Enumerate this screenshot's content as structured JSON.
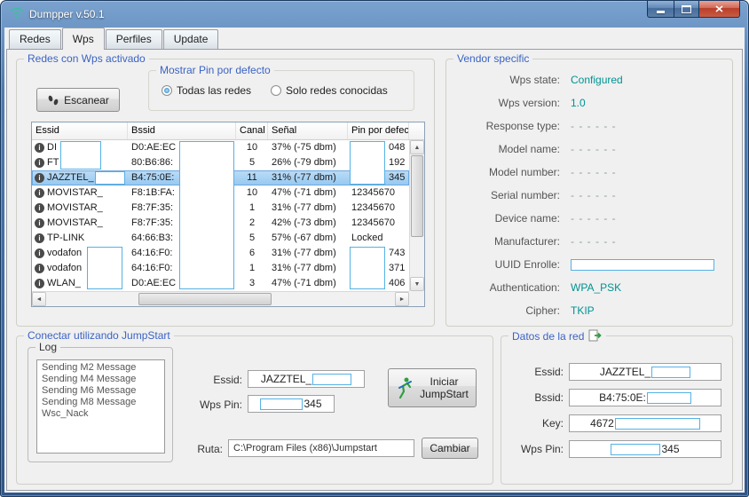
{
  "window": {
    "title": "Dumpper v.50.1"
  },
  "colors": {
    "caption_blue": "#3b63c3",
    "value_teal": "#009292",
    "censor_border": "#55b1e4",
    "selection_blue": "#95c8f1"
  },
  "tabs": [
    {
      "label": "Redes",
      "active": false
    },
    {
      "label": "Wps",
      "active": true
    },
    {
      "label": "Perfiles",
      "active": false
    },
    {
      "label": "Update",
      "active": false
    }
  ],
  "networks": {
    "title": "Redes con Wps activado",
    "scan_button": "Escanear",
    "pin_filter": {
      "title": "Mostrar Pin por defecto",
      "options": [
        {
          "label": "Todas las redes",
          "selected": true
        },
        {
          "label": "Solo redes conocidas",
          "selected": false
        }
      ]
    },
    "columns": [
      "Essid",
      "Bssid",
      "Canal",
      "Señal",
      "Pin por defecto"
    ],
    "rows": [
      {
        "essid": "DI",
        "bssid": "D0:AE:EC",
        "canal": "10",
        "senal": "37% (-75 dbm)",
        "pin": "048",
        "pin_censored": true,
        "selected": false
      },
      {
        "essid": "FT",
        "bssid": "80:B6:86:",
        "canal": "5",
        "senal": "26% (-79 dbm)",
        "pin": "192",
        "pin_censored": true,
        "selected": false
      },
      {
        "essid": "JAZZTEL_",
        "bssid": "B4:75:0E:",
        "canal": "11",
        "senal": "31% (-77 dbm)",
        "pin": "345",
        "pin_censored": true,
        "selected": true
      },
      {
        "essid": "MOVISTAR_",
        "bssid": "F8:1B:FA:",
        "canal": "10",
        "senal": "47% (-71 dbm)",
        "pin": "12345670",
        "pin_censored": false,
        "selected": false
      },
      {
        "essid": "MOVISTAR_",
        "bssid": "F8:7F:35:",
        "canal": "1",
        "senal": "31% (-77 dbm)",
        "pin": "12345670",
        "pin_censored": false,
        "selected": false
      },
      {
        "essid": "MOVISTAR_",
        "bssid": "F8:7F:35:",
        "canal": "2",
        "senal": "42% (-73 dbm)",
        "pin": "12345670",
        "pin_censored": false,
        "selected": false
      },
      {
        "essid": "TP-LINK",
        "bssid": "64:66:B3:",
        "canal": "5",
        "senal": "57% (-67 dbm)",
        "pin": "Locked",
        "pin_censored": false,
        "selected": false
      },
      {
        "essid": "vodafon",
        "bssid": "64:16:F0:",
        "canal": "6",
        "senal": "31% (-77 dbm)",
        "pin": "743",
        "pin_censored": true,
        "selected": false
      },
      {
        "essid": "vodafon",
        "bssid": "64:16:F0:",
        "canal": "1",
        "senal": "31% (-77 dbm)",
        "pin": "371",
        "pin_censored": true,
        "selected": false
      },
      {
        "essid": "WLAN_",
        "bssid": "D0:AE:EC",
        "canal": "3",
        "senal": "47% (-71 dbm)",
        "pin": "406",
        "pin_censored": true,
        "selected": false
      }
    ]
  },
  "vendor": {
    "title": "Vendor specific",
    "fields": [
      {
        "label": "Wps state:",
        "value": "Configured",
        "style": "teal"
      },
      {
        "label": "Wps version:",
        "value": "1.0",
        "style": "teal"
      },
      {
        "label": "Response type:",
        "value": "- - - - - -",
        "style": "dash"
      },
      {
        "label": "Model name:",
        "value": "- - - - - -",
        "style": "dash"
      },
      {
        "label": "Model number:",
        "value": "- - - - - -",
        "style": "dash"
      },
      {
        "label": "Serial number:",
        "value": "- - - - - -",
        "style": "dash"
      },
      {
        "label": "Device name:",
        "value": "- - - - - -",
        "style": "dash"
      },
      {
        "label": "Manufacturer:",
        "value": "- - - - - -",
        "style": "dash"
      },
      {
        "label": "UUID Enrolle:",
        "value": "",
        "style": "censor"
      },
      {
        "label": "Authentication:",
        "value": "WPA_PSK",
        "style": "teal"
      },
      {
        "label": "Cipher:",
        "value": "TKIP",
        "style": "teal"
      }
    ]
  },
  "jumpstart": {
    "title": "Conectar utilizando JumpStart",
    "log": {
      "title": "Log",
      "items": [
        "Sending M2 Message",
        "Sending M4 Message",
        "Sending M6 Message",
        "Sending M8 Message",
        "Wsc_Nack"
      ]
    },
    "essid_label": "Essid:",
    "essid_value": "JAZZTEL_",
    "wps_pin_label": "Wps Pin:",
    "wps_pin_value": "345",
    "start_button": "Iniciar JumpStart",
    "ruta_label": "Ruta:",
    "ruta_value": "C:\\Program Files (x86)\\Jumpstart",
    "cambiar_button": "Cambiar"
  },
  "datos": {
    "title": "Datos de la red",
    "fields": [
      {
        "label": "Essid:",
        "before": "JAZZTEL_",
        "after": "",
        "censor": 44
      },
      {
        "label": "Bssid:",
        "before": "B4:75:0E:",
        "after": "",
        "censor": 50
      },
      {
        "label": "Key:",
        "before": "4672",
        "after": "",
        "censor": 96
      },
      {
        "label": "Wps Pin:",
        "before": "",
        "after": "345",
        "censor": 56
      }
    ]
  }
}
